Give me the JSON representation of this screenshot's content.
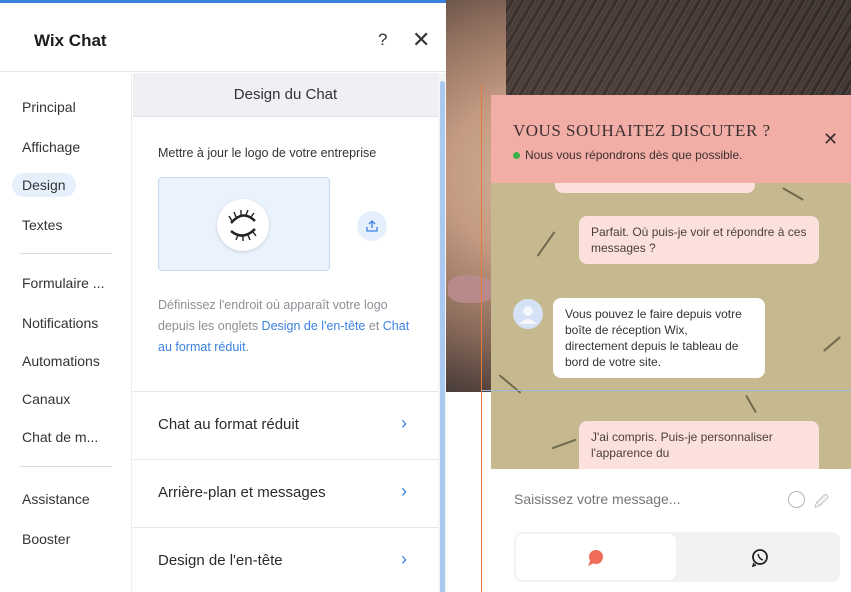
{
  "panel": {
    "title": "Wix Chat",
    "help_label": "?",
    "close_label": "✕"
  },
  "sidenav": {
    "items": [
      {
        "label": "Principal"
      },
      {
        "label": "Affichage"
      },
      {
        "label": "Design"
      },
      {
        "label": "Textes"
      },
      {
        "label": "Formulaire ..."
      },
      {
        "label": "Notifications"
      },
      {
        "label": "Automations"
      },
      {
        "label": "Canaux"
      },
      {
        "label": "Chat de m..."
      },
      {
        "label": "Assistance"
      },
      {
        "label": "Booster"
      }
    ],
    "active": "Design"
  },
  "content": {
    "section_title": "Design du Chat",
    "logo_label": "Mettre à jour le logo de votre entreprise",
    "logo_help_prefix": "Définissez l'endroit où apparaît votre logo depuis les onglets ",
    "logo_help_link1": "Design de l'en-tête",
    "logo_help_mid": " et ",
    "logo_help_link2": "Chat au format réduit",
    "logo_help_suffix": ".",
    "rows": [
      {
        "label": "Chat au format réduit"
      },
      {
        "label": "Arrière-plan et messages"
      },
      {
        "label": "Design de l'en-tête"
      }
    ],
    "chevron": "›"
  },
  "chat": {
    "header_title": "Vous souhaitez discuter ?",
    "status_text": "Nous vous répondrons dès que possible.",
    "close_label": "✕",
    "messages": [
      {
        "from": "user",
        "text": "Parfait. Où puis-je voir et répondre à ces messages ?"
      },
      {
        "from": "bot",
        "text": "Vous pouvez le faire depuis votre boîte de réception Wix, directement depuis le tableau de bord de votre site."
      },
      {
        "from": "user",
        "text": "J'ai compris. Puis-je personnaliser l'apparence du"
      }
    ],
    "input_placeholder": "Saisissez votre message...",
    "colors": {
      "header": "#f2aea6",
      "accent": "#ef6b5a",
      "background": "#c6b98f"
    }
  }
}
